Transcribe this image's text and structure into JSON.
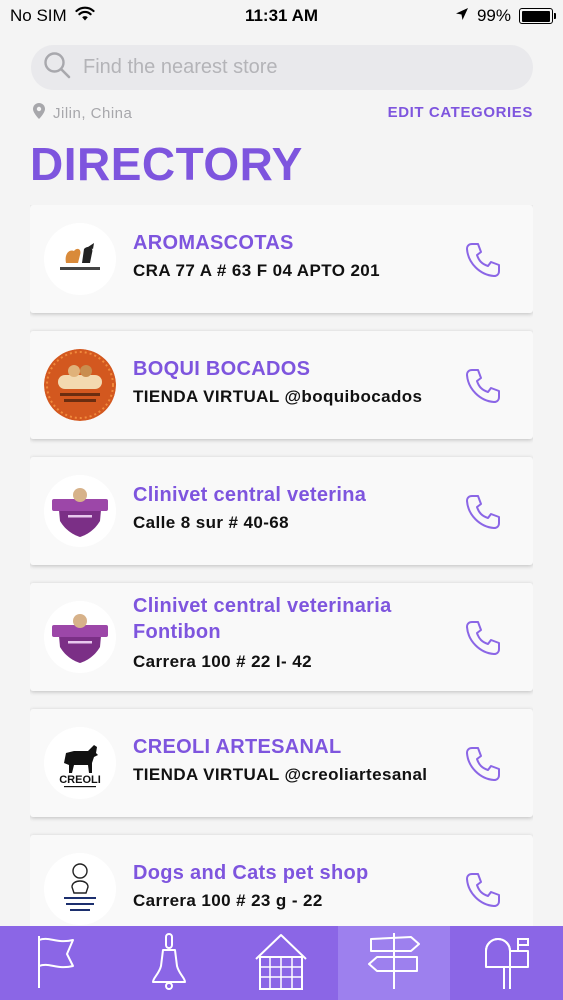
{
  "status_bar": {
    "carrier": "No SIM",
    "time": "11:31 AM",
    "battery": "99%",
    "battery_level": 0.99
  },
  "search": {
    "placeholder": "Find the nearest store",
    "value": ""
  },
  "location": {
    "city": "Jilin, China"
  },
  "edit_categories_label": "EDIT CATEGORIES",
  "page_title": "DIRECTORY",
  "colors": {
    "accent": "#7e55de",
    "tabbar": "#8b66e6",
    "tab_active": "#9d80ee"
  },
  "stores": [
    {
      "name": "AROMASCOTAS",
      "address": "CRA 77 A # 63 F 04  APTO 201",
      "logo_icon": "aromascotas-logo-icon"
    },
    {
      "name": "BOQUI BOCADOS",
      "address": "TIENDA VIRTUAL @boquibocados",
      "logo_icon": "boqui-bocados-logo-icon"
    },
    {
      "name": "Clinivet central veterina",
      "address": "Calle 8 sur # 40-68",
      "logo_icon": "clinivet-logo-icon"
    },
    {
      "name": "Clinivet central veterinaria Fontibon",
      "address": "Carrera 100 # 22 I- 42",
      "logo_icon": "clinivet-logo-icon"
    },
    {
      "name": "CREOLI ARTESANAL",
      "address": "TIENDA VIRTUAL @creoliartesanal",
      "logo_icon": "creoli-logo-icon",
      "logo_text": "CREOLI"
    },
    {
      "name": "Dogs and Cats pet shop",
      "address": "Carrera 100 # 23 g - 22",
      "logo_icon": "dogs-and-cats-logo-icon"
    }
  ],
  "tabbar": {
    "tabs": [
      {
        "icon": "flag-icon",
        "active": false
      },
      {
        "icon": "bell-icon",
        "active": false
      },
      {
        "icon": "barn-icon",
        "active": false
      },
      {
        "icon": "signpost-icon",
        "active": true
      },
      {
        "icon": "mailbox-icon",
        "active": false
      }
    ]
  }
}
